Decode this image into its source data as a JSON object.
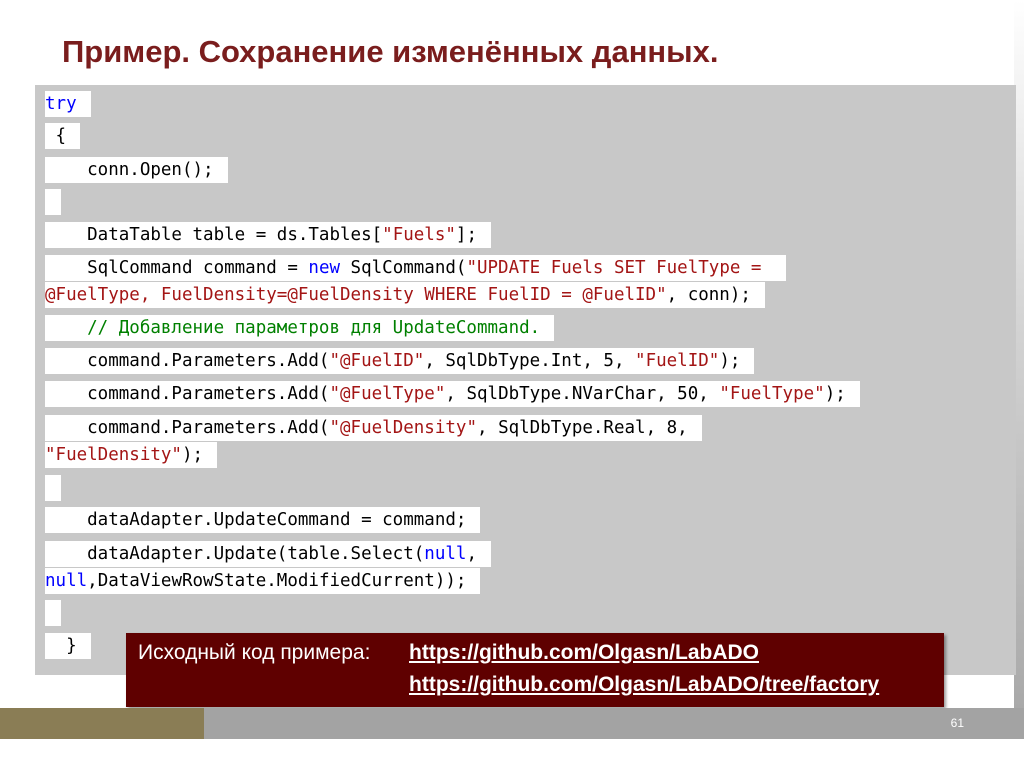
{
  "slide": {
    "title": "Пример. Сохранение изменённых данных.",
    "page_number": "61"
  },
  "code": {
    "l1": {
      "kw": "try"
    },
    "l2": {
      "text": " {"
    },
    "l3": {
      "text": "    conn.Open();"
    },
    "l4": {
      "text": ""
    },
    "l5": {
      "a": "    DataTable table = ds.Tables[",
      "s": "\"Fuels\"",
      "b": "];"
    },
    "l6": {
      "a": "    SqlCommand command = ",
      "kw": "new",
      "b": " SqlCommand(",
      "s": "\"UPDATE Fuels SET FuelType = "
    },
    "l7": {
      "s": "@FuelType, FuelDensity=@FuelDensity WHERE FuelID = @FuelID\"",
      "b": ", conn);"
    },
    "l8": {
      "cmt": "    // Добавление параметров для UpdateCommand."
    },
    "l9": {
      "a": "    command.Parameters.Add(",
      "s1": "\"@FuelID\"",
      "b": ", SqlDbType.Int, 5, ",
      "s2": "\"FuelID\"",
      "c": ");"
    },
    "l10": {
      "a": "    command.Parameters.Add(",
      "s1": "\"@FuelType\"",
      "b": ", SqlDbType.NVarChar, 50, ",
      "s2": "\"FuelType\"",
      "c": ");"
    },
    "l11": {
      "a": "    command.Parameters.Add(",
      "s1": "\"@FuelDensity\"",
      "b": ", SqlDbType.Real, 8,"
    },
    "l12": {
      "s": "\"FuelDensity\"",
      "b": ");"
    },
    "l13": {
      "text": ""
    },
    "l14": {
      "text": "    dataAdapter.UpdateCommand = command;"
    },
    "l15": {
      "a": "    dataAdapter.Update(table.Select(",
      "kw": "null",
      "b": ","
    },
    "l16": {
      "kw": "null",
      "b": ",DataViewRowState.ModifiedCurrent));"
    },
    "l17": {
      "text": ""
    },
    "l18": {
      "text": "  }"
    }
  },
  "source": {
    "label": "Исходный код примера:",
    "link1": "https://github.com/Olgasn/LabADO",
    "link2": "https://github.com/Olgasn/LabADO/tree/factory"
  },
  "colors": {
    "title": "#7a1d1d",
    "source_box": "#5f0000",
    "footer_left": "#8a7d55",
    "footer_right": "#a3a3a3",
    "keyword": "#0000ff",
    "string": "#a31515",
    "comment": "#008000"
  }
}
